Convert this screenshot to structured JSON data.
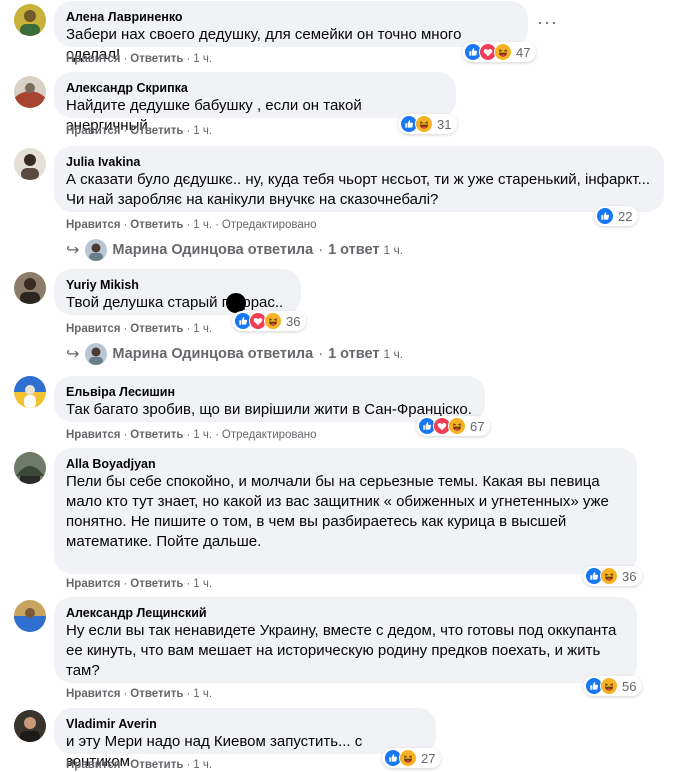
{
  "labels": {
    "like": "Нравится",
    "reply": "Ответить",
    "edited": "Отредактировано",
    "sep": "·"
  },
  "comments": [
    {
      "author": "Алена Лавриненко",
      "text": "Забери нах своего дедушку, для семейки он точно много сделал!",
      "time": "1 ч.",
      "reactions": "47",
      "icons": [
        "like",
        "love",
        "haha"
      ]
    },
    {
      "author": "Александр Скрипка",
      "text": "Найдите дедушке бабушку , если он такой энергичный",
      "time": "1 ч.",
      "reactions": "31",
      "icons": [
        "like",
        "haha"
      ]
    },
    {
      "author": "Julia Ivakina",
      "text": "А сказати було дєдушкє.. ну, куда тебя чьорт нєсьот, ти ж уже старенький, інфаркт... Чи най заробляє на канікули внучкє на сказочнебалі?",
      "time": "1 ч.",
      "edited": true,
      "reactions": "22",
      "icons": [
        "like"
      ]
    },
    {
      "author": "Yuriy Mikish",
      "text": "Твой делушка старый пи  ррас..",
      "time": "1 ч.",
      "reactions": "36",
      "icons": [
        "like",
        "love",
        "haha"
      ]
    },
    {
      "author": "Ельвіра Лесишин",
      "text": "Так багато зробив, що ви вирішили жити в Сан-Франціско.",
      "time": "1 ч.",
      "edited": true,
      "reactions": "67",
      "icons": [
        "like",
        "love",
        "haha"
      ]
    },
    {
      "author": "Alla Boyadjyan",
      "text": "Пели бы себе спокойно, и молчали бы на серьезные темы. Какая вы певица мало кто тут знает, но какой из вас защитник « обиженных и угнетенных» уже понятно. Не пишите о том, в чем вы разбираетесь как курица в высшей математике. Пойте дальше.",
      "time": "1 ч.",
      "reactions": "36",
      "icons": [
        "like",
        "haha"
      ]
    },
    {
      "author": "Александр Лещинский",
      "text": "Ну если вы так ненавидете Украину, вместе с дедом, что готовы под оккупанта ее кинуть, что вам мешает на историческую родину предков поехать, и жить там?",
      "time": "1 ч.",
      "reactions": "56",
      "icons": [
        "like",
        "haha"
      ]
    },
    {
      "author": "Vladimir Averin",
      "text": "и эту Мери надо над Киевом запустить... с зонтиком",
      "time": "1 ч.",
      "reactions": "27",
      "icons": [
        "like",
        "haha"
      ]
    }
  ],
  "reply_threads": [
    {
      "name": "Марина Одинцова ответила",
      "count": "1 ответ",
      "time": "1 ч."
    },
    {
      "name": "Марина Одинцова ответила",
      "count": "1 ответ",
      "time": "1 ч."
    }
  ],
  "more_label": "···",
  "colors": {
    "bubble": "#f0f2f5",
    "meta": "#65676b",
    "like": "#1877f2",
    "love": "#f33e58",
    "haha": "#f7b125"
  }
}
